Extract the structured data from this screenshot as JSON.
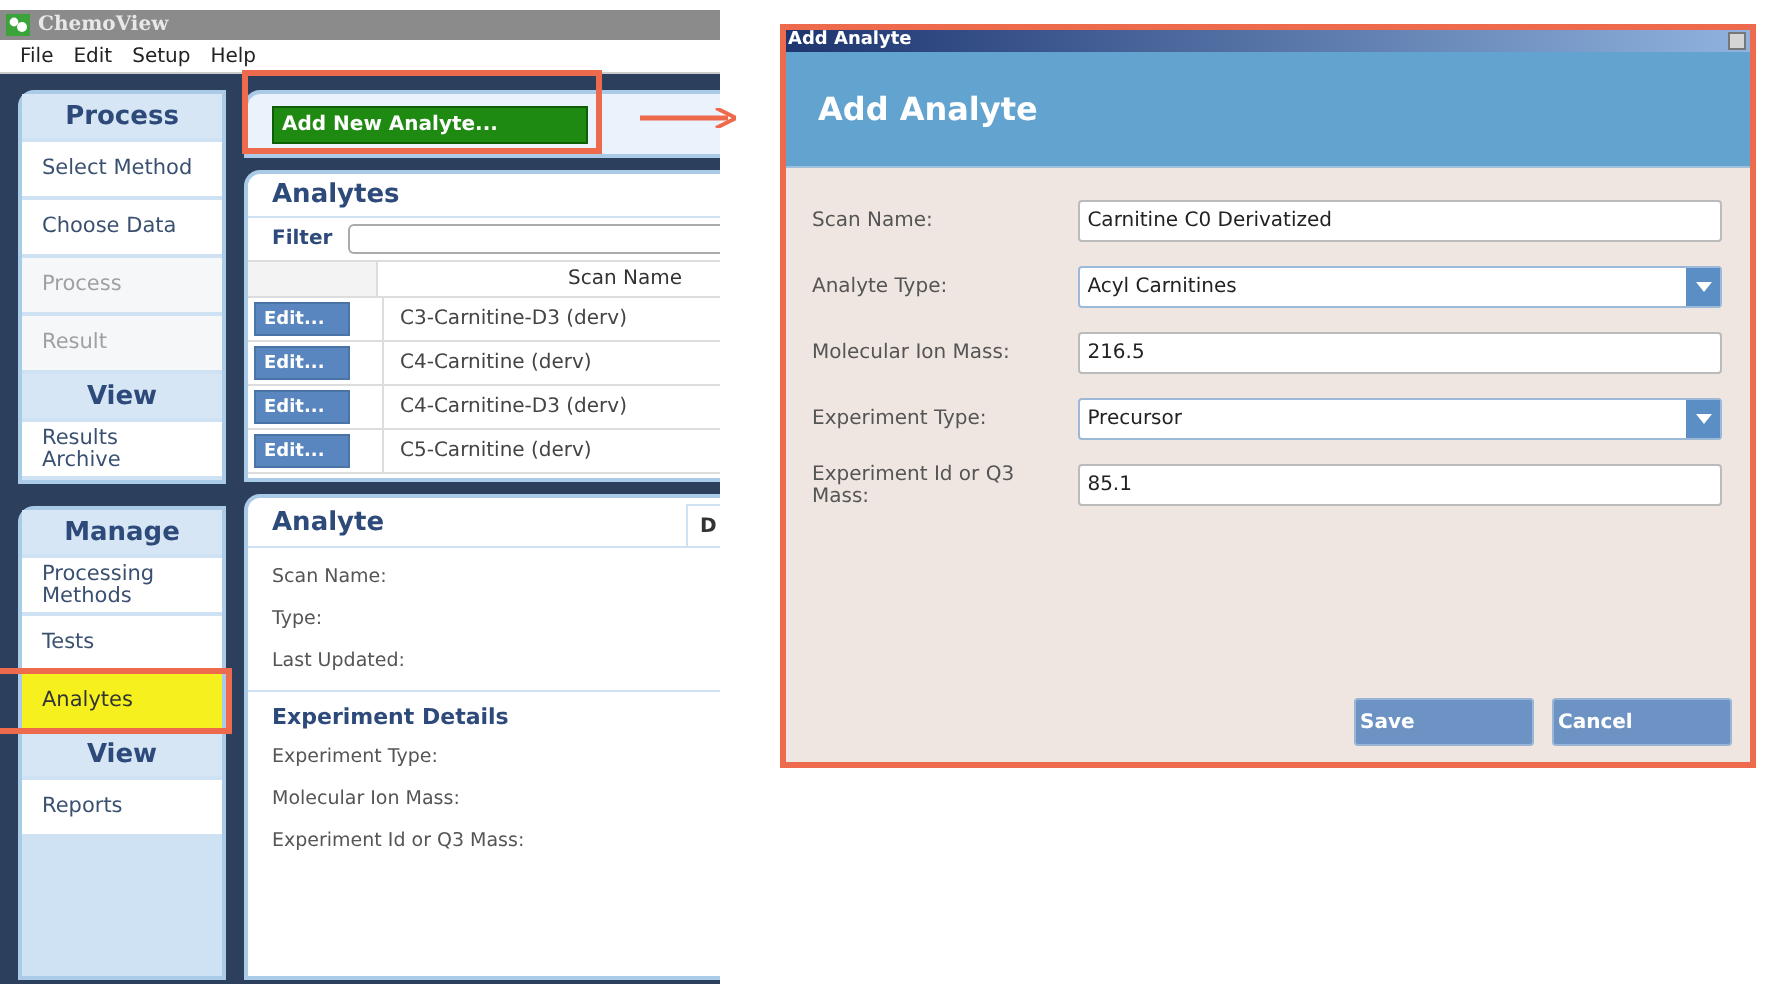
{
  "app": {
    "title": "ChemoView",
    "menu": [
      "File",
      "Edit",
      "Setup",
      "Help"
    ],
    "sidebar": {
      "panels": [
        {
          "groups": [
            {
              "header": "Process",
              "items": [
                {
                  "label": "Select Method",
                  "disabled": false,
                  "selected": false,
                  "callout": false
                },
                {
                  "label": "Choose Data",
                  "disabled": false,
                  "selected": false,
                  "callout": false
                },
                {
                  "label": "Process",
                  "disabled": true,
                  "selected": false,
                  "callout": false
                },
                {
                  "label": "Result",
                  "disabled": true,
                  "selected": false,
                  "callout": false
                }
              ]
            },
            {
              "header": "View",
              "items": [
                {
                  "label": "Results Archive",
                  "disabled": false,
                  "selected": false,
                  "callout": false
                }
              ]
            }
          ]
        },
        {
          "groups": [
            {
              "header": "Manage",
              "items": [
                {
                  "label": "Processing Methods",
                  "disabled": false,
                  "selected": false,
                  "callout": false
                },
                {
                  "label": "Tests",
                  "disabled": false,
                  "selected": false,
                  "callout": false
                },
                {
                  "label": "Analytes",
                  "disabled": false,
                  "selected": true,
                  "callout": true
                }
              ]
            },
            {
              "header": "View",
              "items": [
                {
                  "label": "Reports",
                  "disabled": false,
                  "selected": false,
                  "callout": false
                }
              ]
            }
          ]
        }
      ]
    },
    "toolbar": {
      "button": "Add New Analyte...",
      "callout": true
    },
    "analytes": {
      "title": "Analytes",
      "filter_label": "Filter",
      "column": "Scan Name",
      "rows": [
        {
          "button": "Edit...",
          "scan_name": "C3-Carnitine-D3 (derv)"
        },
        {
          "button": "Edit...",
          "scan_name": "C4-Carnitine (derv)"
        },
        {
          "button": "Edit...",
          "scan_name": "C4-Carnitine-D3 (derv)"
        },
        {
          "button": "Edit...",
          "scan_name": "C5-Carnitine (derv)"
        }
      ]
    },
    "analyte": {
      "title": "Analyte",
      "tab": "D",
      "fields": [
        "Scan Name:",
        "Type:",
        "Last Updated:"
      ],
      "section_title": "Experiment Details",
      "section_fields": [
        "Experiment Type:",
        "Molecular Ion Mass:",
        "Experiment Id or Q3 Mass:"
      ]
    }
  },
  "dialog": {
    "title": "Add Analyte",
    "header": "Add Analyte",
    "callout": true,
    "fields": [
      {
        "label": "Scan Name:",
        "value": "Carnitine C0 Derivatized",
        "kind": "text"
      },
      {
        "label": "Analyte Type:",
        "value": "Acyl Carnitines",
        "kind": "dropdown"
      },
      {
        "label": "Molecular Ion Mass:",
        "value": "216.5",
        "kind": "text"
      },
      {
        "label": "Experiment Type:",
        "value": "Precursor",
        "kind": "dropdown"
      },
      {
        "label": "Experiment Id or Q3 Mass:",
        "value": "85.1",
        "kind": "text"
      }
    ],
    "buttons": [
      "Save",
      "Cancel"
    ]
  }
}
